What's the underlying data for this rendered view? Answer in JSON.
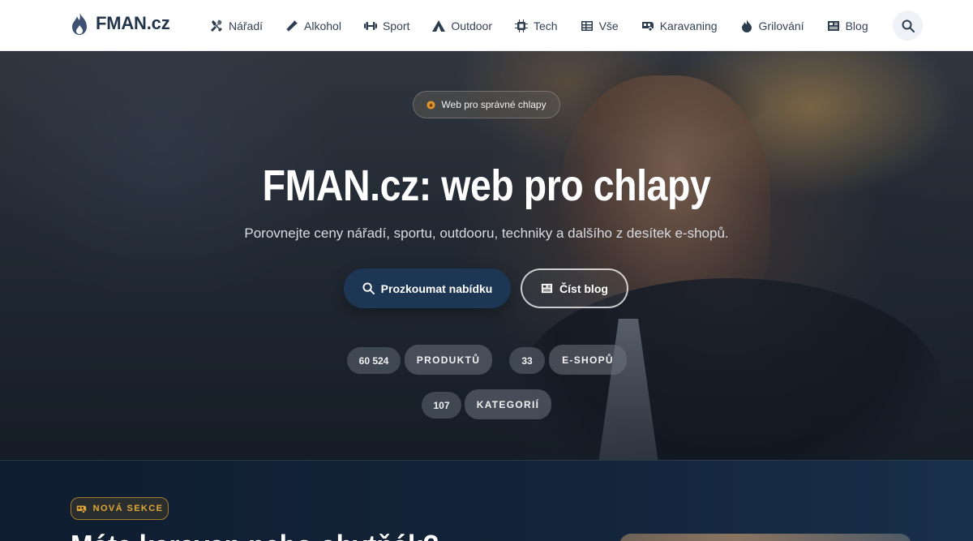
{
  "brand": {
    "name": "FMAN.cz"
  },
  "nav": {
    "items": [
      {
        "label": "Nářadí",
        "icon": "tools-icon"
      },
      {
        "label": "Alkohol",
        "icon": "bottle-icon"
      },
      {
        "label": "Sport",
        "icon": "dumbbell-icon"
      },
      {
        "label": "Outdoor",
        "icon": "tent-icon"
      },
      {
        "label": "Tech",
        "icon": "chip-icon"
      },
      {
        "label": "Vše",
        "icon": "grid-icon"
      },
      {
        "label": "Karavaning",
        "icon": "caravan-icon"
      },
      {
        "label": "Grilování",
        "icon": "flame-icon"
      },
      {
        "label": "Blog",
        "icon": "newspaper-icon"
      }
    ],
    "search_icon": "search-icon"
  },
  "hero": {
    "tag": "Web pro správné chlapy",
    "title": "FMAN.cz: web pro chlapy",
    "subtitle": "Porovnejte ceny nářadí, sportu, outdooru, techniky a dalšího z desítek e-shopů.",
    "primary_button": "Prozkoumat nabídku",
    "secondary_button": "Číst blog",
    "stats": [
      {
        "value": "60 524",
        "label": "PRODUKTŮ"
      },
      {
        "value": "33",
        "label": "E-SHOPŮ"
      },
      {
        "value": "107",
        "label": "KATEGORIÍ"
      }
    ]
  },
  "section": {
    "badge": "NOVÁ SEKCE",
    "title": "Máte karavan nebo obytňák?"
  },
  "colors": {
    "brand": "#23354b",
    "accent": "#e0a73a",
    "primary_button": "#1d3654"
  }
}
